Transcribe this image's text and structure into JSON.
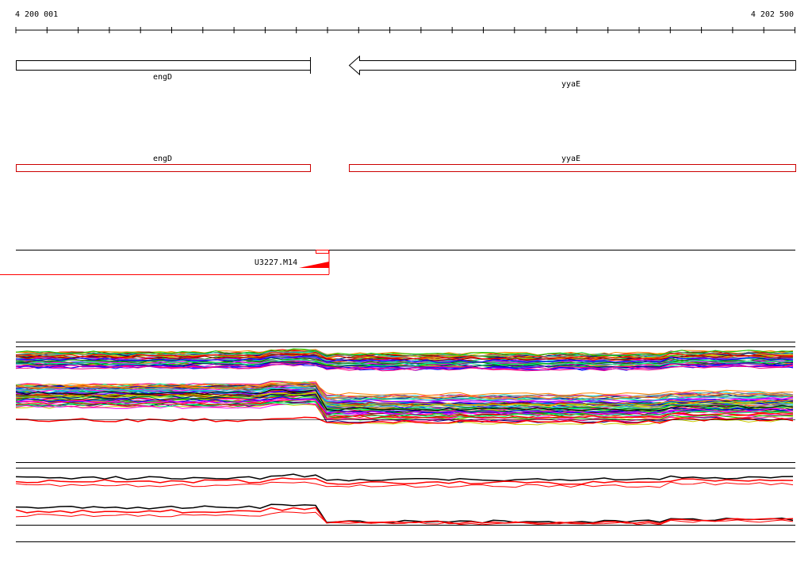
{
  "ruler": {
    "start_label": "4 200 001",
    "end_label": "4 202 500"
  },
  "genes": [
    {
      "name": "engD",
      "strand": "+"
    },
    {
      "name": "yyaE",
      "strand": "-"
    }
  ],
  "cds": [
    {
      "name": "engD"
    },
    {
      "name": "yyaE"
    }
  ],
  "probe": {
    "name": "U3227.M14"
  },
  "colors": {
    "axis": "#000000",
    "cds_outline": "#cc0000",
    "probe": "#ff0000",
    "trace_highlight": "#ff0000"
  }
}
